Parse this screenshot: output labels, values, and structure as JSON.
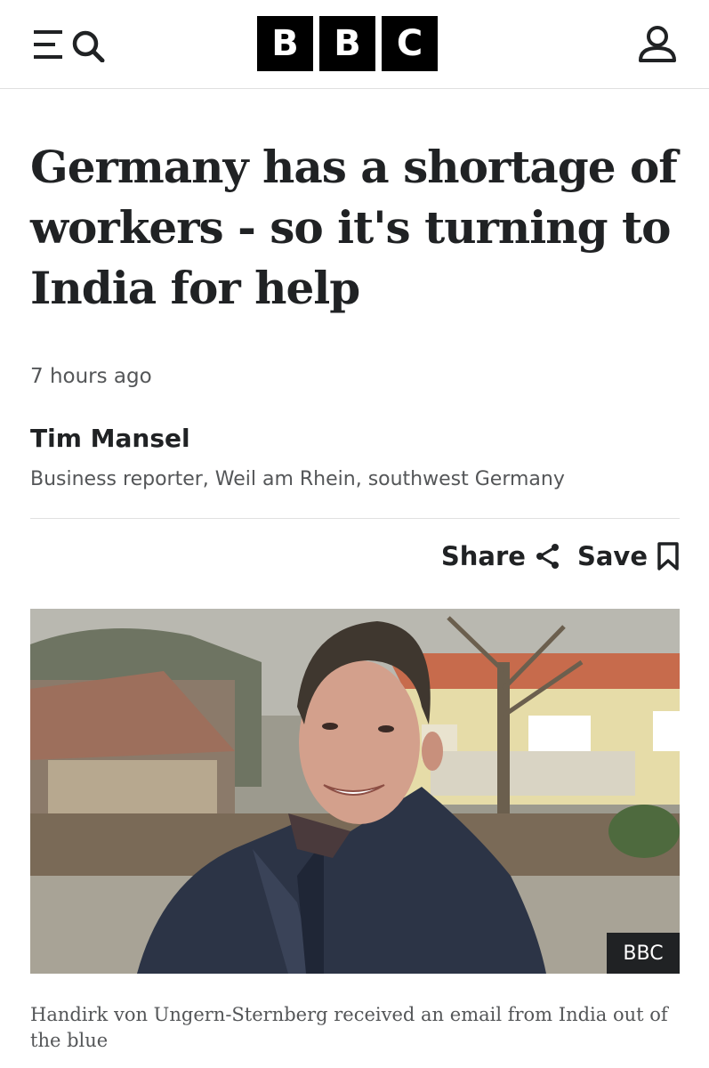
{
  "header": {
    "logo_letters": [
      "B",
      "B",
      "C"
    ],
    "icons": {
      "menu": "menu-icon",
      "search": "search-icon",
      "account": "account-icon"
    }
  },
  "article": {
    "headline": "Germany has a shortage of workers - so it's turning to India for help",
    "timestamp": "7 hours ago",
    "author": "Tim Mansel",
    "author_role": "Business reporter, Weil am Rhein, southwest Germany",
    "share_label": "Share",
    "save_label": "Save",
    "image_credit": "BBC",
    "caption": "Handirk von Ungern-Sternberg received an email from India out of the blue"
  },
  "colors": {
    "text": "#202224",
    "muted": "#545658",
    "logo_bg": "#000000",
    "divider": "#e0e0e0"
  }
}
